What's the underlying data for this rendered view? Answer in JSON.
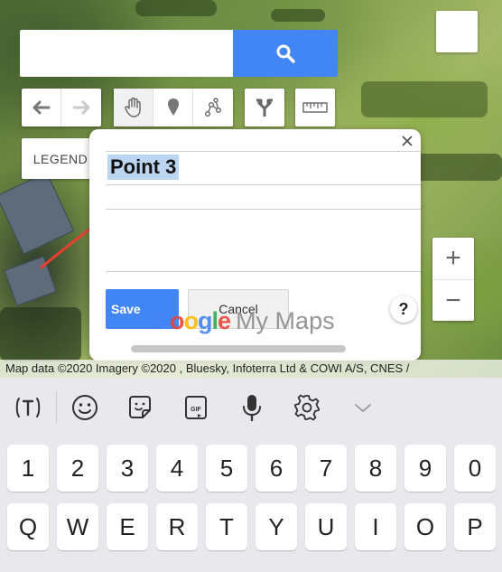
{
  "search": {
    "value": "",
    "placeholder": "",
    "button_icon": "search-icon"
  },
  "toolbar": {
    "groups": [
      [
        "undo-icon",
        "redo-icon"
      ],
      [
        "hand-icon",
        "marker-icon",
        "draw-line-icon"
      ],
      [
        "directions-icon"
      ],
      [
        "ruler-icon"
      ]
    ]
  },
  "legend": {
    "label": "LEGEND"
  },
  "dialog": {
    "title_value": "Point 3",
    "description_value": "",
    "save_label": "Save",
    "cancel_label": "Cancel",
    "help_label": "?"
  },
  "zoom": {
    "in_label": "+",
    "out_label": "−"
  },
  "watermark": {
    "google": [
      "G",
      "o",
      "o",
      "g",
      "l",
      "e"
    ],
    "product": "My Maps"
  },
  "attribution": "Map data ©2020 Imagery ©2020 , Bluesky, Infoterra Ltd & COWI A/S, CNES /",
  "keyboard": {
    "suggestion_bar": [
      "text-style-icon",
      "emoji-icon",
      "sticker-icon",
      "gif-icon",
      "microphone-icon",
      "settings-icon",
      "chevron-down-icon"
    ],
    "number_row": [
      "1",
      "2",
      "3",
      "4",
      "5",
      "6",
      "7",
      "8",
      "9",
      "0"
    ],
    "letter_row": [
      "Q",
      "W",
      "E",
      "R",
      "T",
      "Y",
      "U",
      "I",
      "O",
      "P"
    ]
  },
  "colors": {
    "accent": "#4285f4",
    "selection": "#bcd6f2",
    "annotation": "#e8402f"
  }
}
